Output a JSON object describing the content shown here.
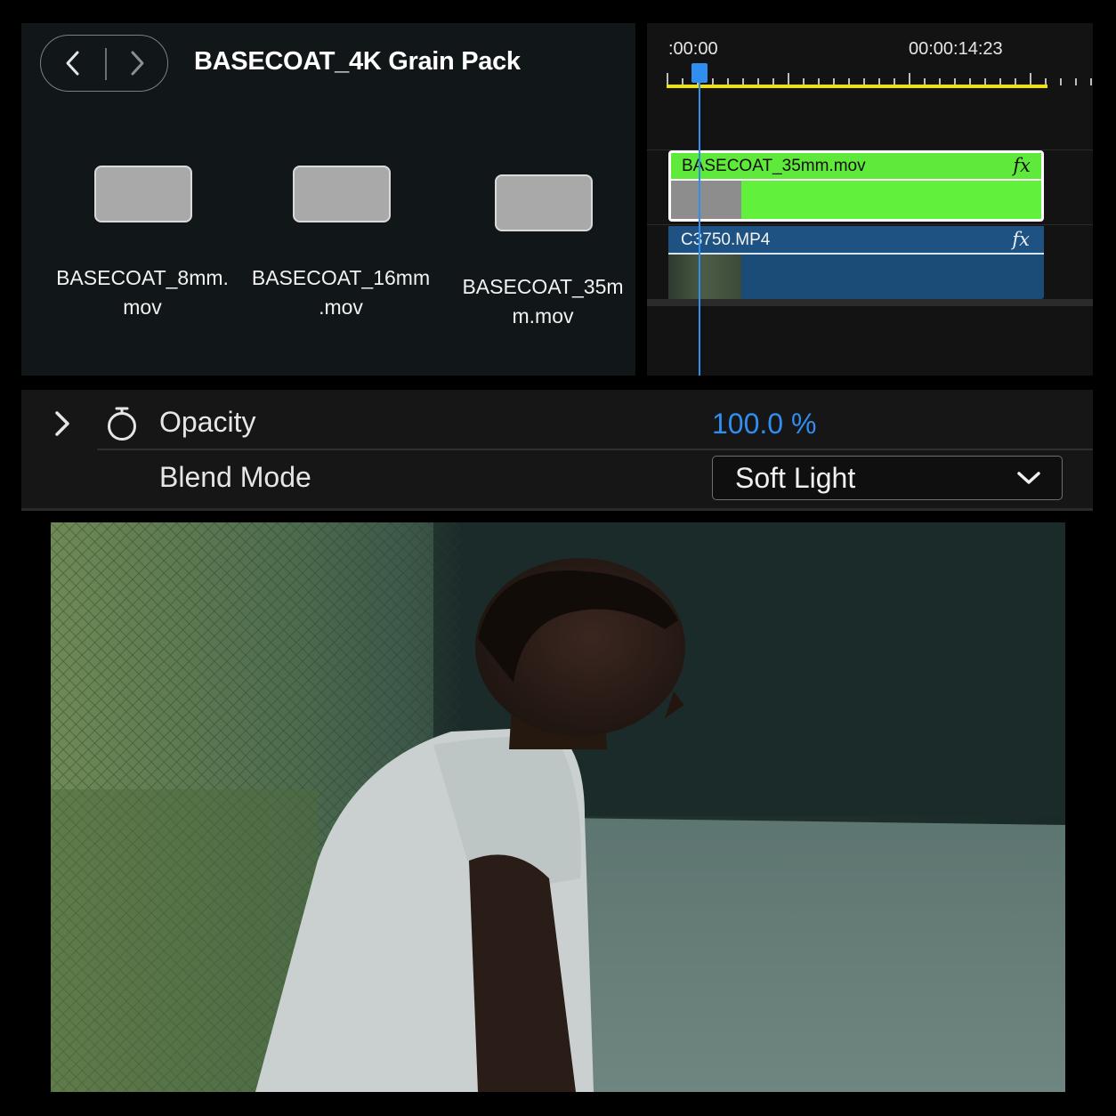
{
  "bin": {
    "title": "BASECOAT_4K Grain Pack",
    "clips": [
      {
        "label": "BASECOAT_8mm.\nmov"
      },
      {
        "label": "BASECOAT_16mm\n.mov"
      },
      {
        "label": "BASECOAT_35m\nm.mov"
      }
    ]
  },
  "timeline": {
    "timecode_start": ":00:00",
    "timecode_current": "00:00:14:23",
    "ruler_color": "#f0e400",
    "playhead_color": "#2f8ef0",
    "tracks": [
      {
        "clip_name": "BASECOAT_35mm.mov",
        "fx": "fx",
        "color": "#61f03b"
      },
      {
        "clip_name": "C3750.MP4",
        "fx": "fx",
        "color": "#1b4b77"
      }
    ]
  },
  "effects": {
    "opacity_label": "Opacity",
    "opacity_value": "100.0 %",
    "blend_label": "Blend Mode",
    "blend_value": "Soft Light",
    "accent_color": "#2f8ef0"
  }
}
